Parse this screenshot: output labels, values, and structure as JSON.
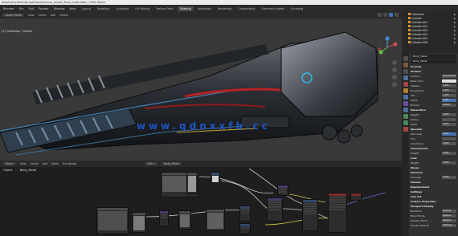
{
  "app": {
    "title": "absolutely/blender/path/to/a/scene_model_final_production_1999.blend"
  },
  "menubar": {
    "menus": [
      "Blender",
      "File",
      "Edit",
      "Render",
      "Window",
      "Help"
    ],
    "workspaces": [
      "Layout",
      "Modeling",
      "Sculpting",
      "UV Editing",
      "Texture Paint",
      "Shading",
      "Animation",
      "Rendering",
      "Compositing",
      "Geometry Nodes",
      "Scripting"
    ],
    "active_workspace": "Shading"
  },
  "viewport": {
    "header_items": [
      "Object Mode",
      "View",
      "Select",
      "Add",
      "Object"
    ],
    "info_text": "(1) Collection | Object",
    "mode": "Object Mode"
  },
  "watermark": {
    "text": "www.qdnxxfb.cc"
  },
  "node_editor": {
    "header_items": [
      "Object",
      "View",
      "Select",
      "Add",
      "Node",
      "Use Nodes"
    ],
    "slot_label": "Slot 1",
    "material_name": "Body_Metal",
    "breadcrumb": [
      "Object",
      "Body_Metal"
    ]
  },
  "outliner": {
    "items": [
      "Collection",
      "Cylinder",
      "Cylinder.001",
      "Cylinder.002",
      "Cylinder.003",
      "Cylinder.004",
      "Cylinder.005",
      "Cylinder.006"
    ]
  },
  "properties": {
    "object_name": "Body_Metal",
    "material_slot": "Body_Metal",
    "rows": [
      {
        "label": "Preview",
        "type": "section"
      },
      {
        "label": "Surface",
        "type": "section"
      },
      {
        "label": "Surface",
        "value": "Principled BSDF"
      },
      {
        "label": "Base Color",
        "value": ""
      },
      {
        "label": "Metallic",
        "value": "1.000"
      },
      {
        "label": "Roughness",
        "value": "0.250"
      },
      {
        "label": "IOR",
        "value": "1.450"
      },
      {
        "label": "Alpha",
        "value": "1.000"
      },
      {
        "label": "Normal",
        "value": "Default"
      },
      {
        "label": "Subsurface",
        "type": "section"
      },
      {
        "label": "Weight",
        "value": "0.000"
      },
      {
        "label": "Radius",
        "value": ""
      },
      {
        "label": "Scale",
        "value": "0.050"
      },
      {
        "label": "Specular",
        "type": "section"
      },
      {
        "label": "IOR Level",
        "value": "0.500"
      },
      {
        "label": "Tint",
        "value": ""
      },
      {
        "label": "Anisotropic",
        "value": "0.000"
      },
      {
        "label": "Transmission",
        "type": "section"
      },
      {
        "label": "Weight",
        "value": "0.000"
      },
      {
        "label": "Coat",
        "type": "section"
      },
      {
        "label": "Weight",
        "value": "0.000"
      },
      {
        "label": "Sheen",
        "type": "section"
      },
      {
        "label": "Emission",
        "type": "section"
      },
      {
        "label": "Strength",
        "value": "0.000"
      },
      {
        "label": "Volume",
        "type": "section"
      },
      {
        "label": "Displacement",
        "type": "section"
      },
      {
        "label": "Settings",
        "type": "section"
      },
      {
        "label": "Line Art",
        "type": "section"
      },
      {
        "label": "Custom Properties",
        "type": "section"
      },
      {
        "label": "Viewport Display",
        "type": "section"
      },
      {
        "label": "Backface",
        "value": "Opaque"
      },
      {
        "label": "Blend Mode",
        "value": "Opaque"
      },
      {
        "label": "Shadow Mode",
        "value": "Opaque"
      },
      {
        "label": "Render Method",
        "value": "Dithered"
      }
    ]
  },
  "colors": {
    "accent": "#4773b3",
    "watermark": "#1e5ad6",
    "background": "#1d1d1d",
    "viewport": "#393939"
  }
}
